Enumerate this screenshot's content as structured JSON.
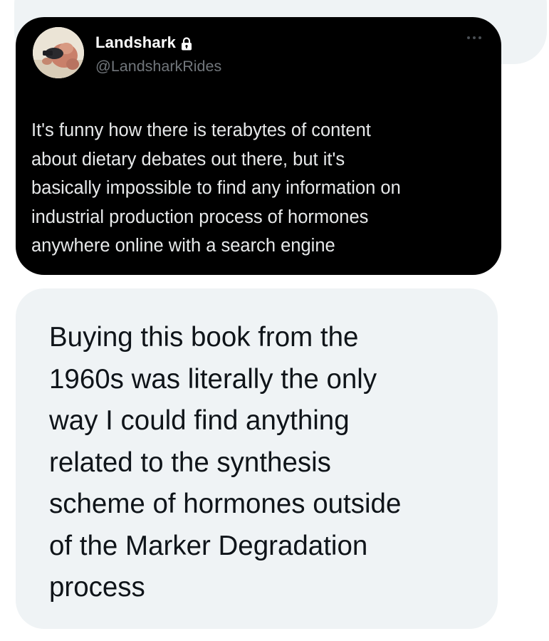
{
  "tweet": {
    "display_name": "Landshark",
    "handle": "@LandsharkRides",
    "protected_icon": "lock-icon",
    "more_icon": "more-dots-icon",
    "text": "It's funny how there is terabytes of content\nabout dietary debates out there, but it's\nbasically impossible to find any information on\nindustrial production process of hormones\nanywhere online with a search engine"
  },
  "reply": {
    "text": "Buying this book from the\n1960s was literally the only\nway I could find anything\nrelated to the synthesis\nscheme of hormones outside\nof the Marker Degradation\nprocess"
  },
  "colors": {
    "tweet_background": "#000000",
    "tweet_text": "#e7e9ea",
    "handle_text": "#71767b",
    "reply_background": "#eff3f5",
    "reply_text": "#0f1419"
  }
}
